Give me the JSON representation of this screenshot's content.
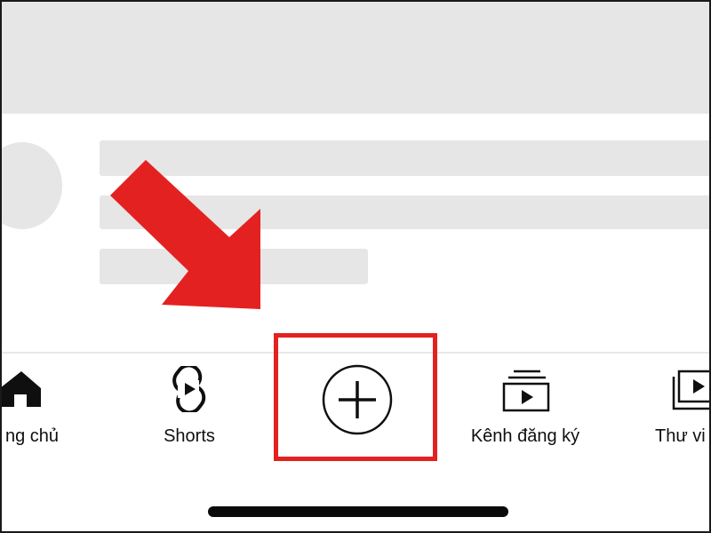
{
  "bottom_nav": {
    "items": [
      {
        "id": "home",
        "label": "ng chủ",
        "icon": "home-icon"
      },
      {
        "id": "shorts",
        "label": "Shorts",
        "icon": "shorts-icon"
      },
      {
        "id": "create",
        "label": "",
        "icon": "plus-circle-icon"
      },
      {
        "id": "subscriptions",
        "label": "Kênh đăng ký",
        "icon": "subscriptions-icon"
      },
      {
        "id": "library",
        "label": "Thư vi",
        "icon": "library-icon"
      }
    ]
  },
  "annotation": {
    "arrow_color": "#e42121",
    "highlight_color": "#e42121"
  },
  "colors": {
    "placeholder": "#e6e6e6",
    "icon": "#0f0f0f",
    "background": "#ffffff"
  }
}
